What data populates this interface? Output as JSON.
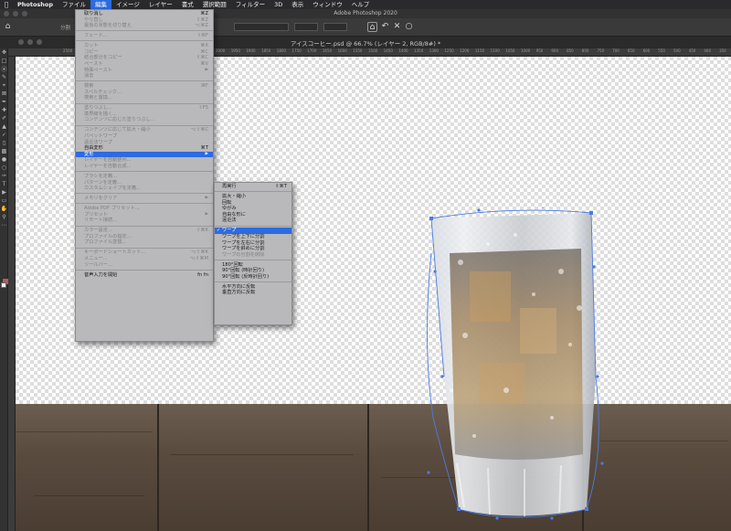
{
  "menubar": {
    "app": "Photoshop",
    "items": [
      "ファイル",
      "編集",
      "イメージ",
      "レイヤー",
      "書式",
      "選択範囲",
      "フィルター",
      "3D",
      "表示",
      "ウィンドウ",
      "ヘルプ"
    ],
    "active_index": 1
  },
  "window": {
    "title": "Adobe Photoshop 2020"
  },
  "document": {
    "tab_title": "アイスコーヒー.psd @ 66.7% (レイヤー 2, RGB/8#) *"
  },
  "options_bar": {
    "split_label": "分割"
  },
  "ruler": {
    "ticks": [
      "2500",
      "2450",
      "2400",
      "2350",
      "2300",
      "2250",
      "2200",
      "2150",
      "2100",
      "2050",
      "2000",
      "1950",
      "1900",
      "1850",
      "1800",
      "1750",
      "1700",
      "1650",
      "1600",
      "1550",
      "1500",
      "1450",
      "1400",
      "1350",
      "1300",
      "1250",
      "1200",
      "1150",
      "1100",
      "1050",
      "1000",
      "950",
      "900",
      "850",
      "800",
      "750",
      "700",
      "650",
      "600",
      "550",
      "500",
      "450",
      "400",
      "350",
      "300",
      "250",
      "200"
    ]
  },
  "edit_menu": {
    "groups": [
      [
        {
          "label": "取り消し",
          "shortcut": "⌘Z",
          "enabled": true
        },
        {
          "label": "やり直し",
          "shortcut": "⇧⌘Z",
          "enabled": false
        },
        {
          "label": "最後の状態を切り替え",
          "shortcut": "⌥⌘Z",
          "enabled": false
        }
      ],
      [
        {
          "label": "フェード...",
          "shortcut": "⇧⌘F",
          "enabled": false
        }
      ],
      [
        {
          "label": "カット",
          "shortcut": "⌘X",
          "enabled": false
        },
        {
          "label": "コピー",
          "shortcut": "⌘C",
          "enabled": false
        },
        {
          "label": "結合部分をコピー",
          "shortcut": "⇧⌘C",
          "enabled": false
        },
        {
          "label": "ペースト",
          "shortcut": "⌘V",
          "enabled": false
        },
        {
          "label": "特殊ペースト",
          "shortcut": "",
          "enabled": false,
          "submenu": true
        },
        {
          "label": "消去",
          "shortcut": "",
          "enabled": false
        }
      ],
      [
        {
          "label": "検索",
          "shortcut": "⌘F",
          "enabled": false
        },
        {
          "label": "スペルチェック...",
          "shortcut": "",
          "enabled": false
        },
        {
          "label": "検索と置換...",
          "shortcut": "",
          "enabled": false
        }
      ],
      [
        {
          "label": "塗りつぶし...",
          "shortcut": "⇧F5",
          "enabled": false
        },
        {
          "label": "境界線を描く...",
          "shortcut": "",
          "enabled": false
        },
        {
          "label": "コンテンツに応じた塗りつぶし...",
          "shortcut": "",
          "enabled": false
        }
      ],
      [
        {
          "label": "コンテンツに応じて拡大・縮小",
          "shortcut": "⌥⇧⌘C",
          "enabled": false
        },
        {
          "label": "パペットワープ",
          "shortcut": "",
          "enabled": false
        },
        {
          "label": "遠近法ワープ",
          "shortcut": "",
          "enabled": false
        },
        {
          "label": "自由変形",
          "shortcut": "⌘T",
          "enabled": true
        },
        {
          "label": "変形",
          "shortcut": "",
          "enabled": true,
          "submenu": true,
          "highlighted": true
        },
        {
          "label": "レイヤーを自動整列...",
          "shortcut": "",
          "enabled": false
        },
        {
          "label": "レイヤーを自動合成...",
          "shortcut": "",
          "enabled": false
        }
      ],
      [
        {
          "label": "ブラシを定義...",
          "shortcut": "",
          "enabled": false
        },
        {
          "label": "パターンを定義...",
          "shortcut": "",
          "enabled": false
        },
        {
          "label": "カスタムシェイプを定義...",
          "shortcut": "",
          "enabled": false
        }
      ],
      [
        {
          "label": "メモリをクリア",
          "shortcut": "",
          "enabled": false,
          "submenu": true
        }
      ],
      [
        {
          "label": "Adobe PDF プリセット...",
          "shortcut": "",
          "enabled": false
        },
        {
          "label": "プリセット",
          "shortcut": "",
          "enabled": false,
          "submenu": true
        },
        {
          "label": "リモート接続...",
          "shortcut": "",
          "enabled": false
        }
      ],
      [
        {
          "label": "カラー設定...",
          "shortcut": "⇧⌘K",
          "enabled": false
        },
        {
          "label": "プロファイルの指定...",
          "shortcut": "",
          "enabled": false
        },
        {
          "label": "プロファイル変換...",
          "shortcut": "",
          "enabled": false
        }
      ],
      [
        {
          "label": "キーボードショートカット...",
          "shortcut": "⌥⇧⌘K",
          "enabled": false
        },
        {
          "label": "メニュー...",
          "shortcut": "⌥⇧⌘M",
          "enabled": false
        },
        {
          "label": "ツールバー...",
          "shortcut": "",
          "enabled": false
        }
      ],
      [
        {
          "label": "音声入力を開始",
          "shortcut": "fn fn",
          "enabled": true
        }
      ]
    ]
  },
  "transform_menu": {
    "groups": [
      [
        {
          "label": "再実行",
          "shortcut": "⇧⌘T",
          "enabled": true
        }
      ],
      [
        {
          "label": "拡大・縮小",
          "enabled": true
        },
        {
          "label": "回転",
          "enabled": true
        },
        {
          "label": "ゆがみ",
          "enabled": true
        },
        {
          "label": "自由な形に",
          "enabled": true
        },
        {
          "label": "遠近法",
          "enabled": true
        }
      ],
      [
        {
          "label": "ワープ",
          "enabled": true,
          "checked": true,
          "highlighted": true
        },
        {
          "label": "ワープを上下に分割",
          "enabled": true
        },
        {
          "label": "ワープを左右に分割",
          "enabled": true
        },
        {
          "label": "ワープを斜めに分割",
          "enabled": true
        },
        {
          "label": "ワープの分割を削除",
          "enabled": false
        }
      ],
      [
        {
          "label": "180°回転",
          "enabled": true
        },
        {
          "label": "90°回転 (時計回り)",
          "enabled": true
        },
        {
          "label": "90°回転 (反時計回り)",
          "enabled": true
        }
      ],
      [
        {
          "label": "水平方向に反転",
          "enabled": true
        },
        {
          "label": "垂直方向に反転",
          "enabled": true
        }
      ]
    ]
  },
  "colors": {
    "accent": "#2d6be0",
    "warp_handles": "#4b7ce0"
  }
}
